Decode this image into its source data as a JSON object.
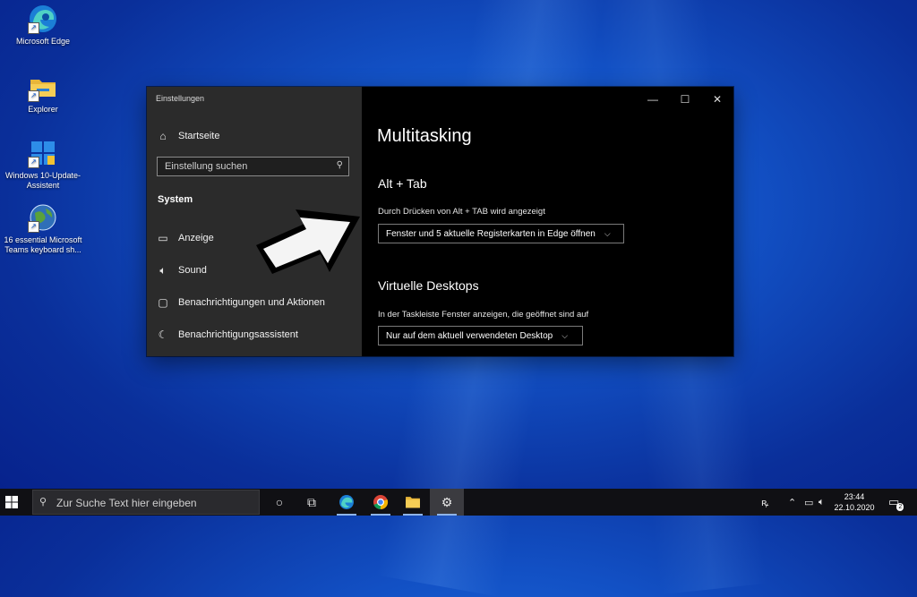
{
  "desktop": {
    "icons": [
      {
        "label": "Microsoft Edge",
        "icon": "edge-icon"
      },
      {
        "label": "Explorer",
        "icon": "folder-icon"
      },
      {
        "label": "Windows 10-Update-Assistent",
        "icon": "windows-update-icon"
      },
      {
        "label": "16 essential Microsoft Teams keyboard sh...",
        "icon": "globe-icon"
      }
    ]
  },
  "settings": {
    "window_title": "Einstellungen",
    "home_label": "Startseite",
    "search_placeholder": "Einstellung suchen",
    "section_label": "System",
    "nav_items": [
      {
        "label": "Anzeige",
        "icon": "display-icon"
      },
      {
        "label": "Sound",
        "icon": "speaker-icon"
      },
      {
        "label": "Benachrichtigungen und Aktionen",
        "icon": "notification-icon"
      },
      {
        "label": "Benachrichtigungsassistent",
        "icon": "moon-icon"
      }
    ],
    "page_title": "Multitasking",
    "alt_tab": {
      "heading": "Alt + Tab",
      "description": "Durch Drücken von Alt + TAB wird angezeigt",
      "selected": "Fenster und 5 aktuelle Registerkarten in Edge öffnen"
    },
    "virtual_desktops": {
      "heading": "Virtuelle Desktops",
      "description": "In der Taskleiste Fenster anzeigen, die geöffnet sind auf",
      "selected": "Nur auf dem aktuell verwendeten Desktop"
    }
  },
  "taskbar": {
    "search_placeholder": "Zur Suche Text hier eingeben",
    "time": "23:44",
    "date": "22.10.2020",
    "notification_count": "2"
  },
  "colors": {
    "sidebar_bg": "#2b2b2b",
    "content_bg": "#000000",
    "desktop_blue": "#1250c4",
    "taskbar_bg": "#101014"
  }
}
